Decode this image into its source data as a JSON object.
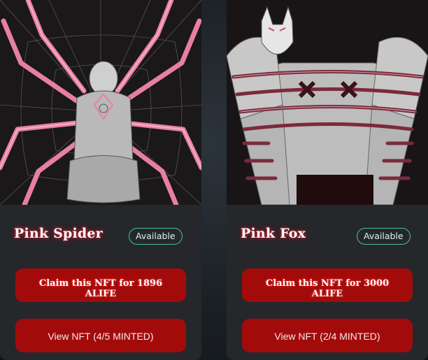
{
  "cards": [
    {
      "title": "Pink Spider",
      "status": "Available",
      "claim_label": "Claim this NFT for 1896 ALIFE",
      "view_label": "View NFT (4/5 MINTED)"
    },
    {
      "title": "Pink Fox",
      "status": "Available",
      "claim_label": "Claim this NFT for 3000 ALIFE",
      "view_label": "View NFT (2/4 MINTED)"
    }
  ],
  "colors": {
    "card_bg": "#25272b",
    "button_red": "#a30b0b",
    "badge_teal": "#3fc4a4",
    "art_pink": "#e87fa3"
  }
}
